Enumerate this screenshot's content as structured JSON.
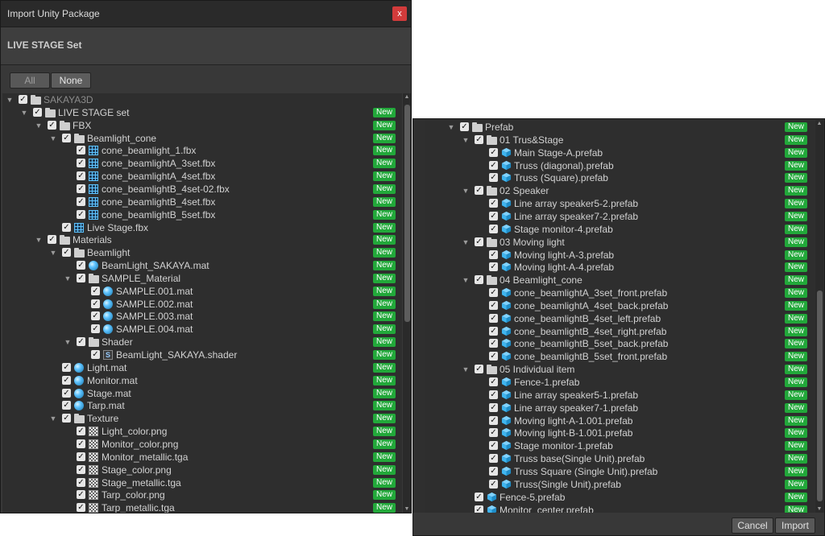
{
  "dialog": {
    "title": "Import Unity Package",
    "close_label": "x",
    "package_name": "LIVE STAGE Set",
    "all_label": "All",
    "none_label": "None",
    "new_label": "New",
    "cancel_label": "Cancel",
    "import_label": "Import"
  },
  "left_tree": [
    {
      "label": "SAKAYA3D",
      "depth": 0,
      "icon": "folder-icon",
      "fold": true,
      "dim": true,
      "badge": false
    },
    {
      "label": "LIVE STAGE set",
      "depth": 1,
      "icon": "folder-icon",
      "fold": true,
      "badge": true
    },
    {
      "label": "FBX",
      "depth": 2,
      "icon": "folder-icon",
      "fold": true,
      "badge": true
    },
    {
      "label": "Beamlight_cone",
      "depth": 3,
      "icon": "folder-icon",
      "fold": true,
      "badge": true
    },
    {
      "label": "cone_beamlight_1.fbx",
      "depth": 4,
      "icon": "fbx-icon",
      "badge": true
    },
    {
      "label": "cone_beamlightA_3set.fbx",
      "depth": 4,
      "icon": "fbx-icon",
      "badge": true
    },
    {
      "label": "cone_beamlightA_4set.fbx",
      "depth": 4,
      "icon": "fbx-icon",
      "badge": true
    },
    {
      "label": "cone_beamlightB_4set-02.fbx",
      "depth": 4,
      "icon": "fbx-icon",
      "badge": true
    },
    {
      "label": "cone_beamlightB_4set.fbx",
      "depth": 4,
      "icon": "fbx-icon",
      "badge": true
    },
    {
      "label": "cone_beamlightB_5set.fbx",
      "depth": 4,
      "icon": "fbx-icon",
      "badge": true
    },
    {
      "label": "Live Stage.fbx",
      "depth": 3,
      "icon": "fbx-icon",
      "badge": true
    },
    {
      "label": "Materials",
      "depth": 2,
      "icon": "folder-icon",
      "fold": true,
      "badge": true
    },
    {
      "label": "Beamlight",
      "depth": 3,
      "icon": "folder-icon",
      "fold": true,
      "badge": true
    },
    {
      "label": "BeamLight_SAKAYA.mat",
      "depth": 4,
      "icon": "material-icon",
      "badge": true
    },
    {
      "label": "SAMPLE_Material",
      "depth": 4,
      "icon": "folder-icon",
      "fold": true,
      "badge": true
    },
    {
      "label": "SAMPLE.001.mat",
      "depth": 5,
      "icon": "material-icon",
      "badge": true
    },
    {
      "label": "SAMPLE.002.mat",
      "depth": 5,
      "icon": "material-icon",
      "badge": true
    },
    {
      "label": "SAMPLE.003.mat",
      "depth": 5,
      "icon": "material-icon",
      "badge": true
    },
    {
      "label": "SAMPLE.004.mat",
      "depth": 5,
      "icon": "material-icon",
      "badge": true
    },
    {
      "label": "Shader",
      "depth": 4,
      "icon": "folder-icon",
      "fold": true,
      "badge": true
    },
    {
      "label": "BeamLight_SAKAYA.shader",
      "depth": 5,
      "icon": "shader-icon",
      "badge": true
    },
    {
      "label": "Light.mat",
      "depth": 3,
      "icon": "material-icon",
      "badge": true
    },
    {
      "label": "Monitor.mat",
      "depth": 3,
      "icon": "material-icon",
      "badge": true
    },
    {
      "label": "Stage.mat",
      "depth": 3,
      "icon": "material-icon",
      "badge": true
    },
    {
      "label": "Tarp.mat",
      "depth": 3,
      "icon": "material-icon",
      "badge": true
    },
    {
      "label": "Texture",
      "depth": 3,
      "icon": "folder-icon",
      "fold": true,
      "badge": true
    },
    {
      "label": "Light_color.png",
      "depth": 4,
      "icon": "texture-icon",
      "badge": true
    },
    {
      "label": "Monitor_color.png",
      "depth": 4,
      "icon": "texture-icon",
      "badge": true
    },
    {
      "label": "Monitor_metallic.tga",
      "depth": 4,
      "icon": "texture-icon",
      "badge": true
    },
    {
      "label": "Stage_color.png",
      "depth": 4,
      "icon": "texture-icon",
      "badge": true
    },
    {
      "label": "Stage_metallic.tga",
      "depth": 4,
      "icon": "texture-icon",
      "badge": true
    },
    {
      "label": "Tarp_color.png",
      "depth": 4,
      "icon": "texture-icon",
      "badge": true
    },
    {
      "label": "Tarp_metallic.tga",
      "depth": 4,
      "icon": "texture-icon",
      "badge": true
    }
  ],
  "right_tree": [
    {
      "label": "Prefab",
      "depth": 2,
      "icon": "folder-icon",
      "fold": true,
      "badge": true
    },
    {
      "label": "01 Trus&Stage",
      "depth": 3,
      "icon": "folder-icon",
      "fold": true,
      "badge": true
    },
    {
      "label": "Main Stage-A.prefab",
      "depth": 4,
      "icon": "prefab-icon",
      "badge": true
    },
    {
      "label": "Truss (diagonal).prefab",
      "depth": 4,
      "icon": "prefab-icon",
      "badge": true
    },
    {
      "label": "Truss (Square).prefab",
      "depth": 4,
      "icon": "prefab-icon",
      "badge": true
    },
    {
      "label": "02 Speaker",
      "depth": 3,
      "icon": "folder-icon",
      "fold": true,
      "badge": true
    },
    {
      "label": "Line array speaker5-2.prefab",
      "depth": 4,
      "icon": "prefab-icon",
      "badge": true
    },
    {
      "label": "Line array speaker7-2.prefab",
      "depth": 4,
      "icon": "prefab-icon",
      "badge": true
    },
    {
      "label": "Stage monitor-4.prefab",
      "depth": 4,
      "icon": "prefab-icon",
      "badge": true
    },
    {
      "label": "03 Moving light",
      "depth": 3,
      "icon": "folder-icon",
      "fold": true,
      "badge": true
    },
    {
      "label": "Moving light-A-3.prefab",
      "depth": 4,
      "icon": "prefab-icon",
      "badge": true
    },
    {
      "label": "Moving light-A-4.prefab",
      "depth": 4,
      "icon": "prefab-icon",
      "badge": true
    },
    {
      "label": "04 Beamlight_cone",
      "depth": 3,
      "icon": "folder-icon",
      "fold": true,
      "badge": true
    },
    {
      "label": "cone_beamlightA_3set_front.prefab",
      "depth": 4,
      "icon": "prefab-icon",
      "badge": true
    },
    {
      "label": "cone_beamlightA_4set_back.prefab",
      "depth": 4,
      "icon": "prefab-icon",
      "badge": true
    },
    {
      "label": "cone_beamlightB_4set_left.prefab",
      "depth": 4,
      "icon": "prefab-icon",
      "badge": true
    },
    {
      "label": "cone_beamlightB_4set_right.prefab",
      "depth": 4,
      "icon": "prefab-icon",
      "badge": true
    },
    {
      "label": "cone_beamlightB_5set_back.prefab",
      "depth": 4,
      "icon": "prefab-icon",
      "badge": true
    },
    {
      "label": "cone_beamlightB_5set_front.prefab",
      "depth": 4,
      "icon": "prefab-icon",
      "badge": true
    },
    {
      "label": "05 Individual item",
      "depth": 3,
      "icon": "folder-icon",
      "fold": true,
      "badge": true
    },
    {
      "label": "Fence-1.prefab",
      "depth": 4,
      "icon": "prefab-icon",
      "badge": true
    },
    {
      "label": "Line array speaker5-1.prefab",
      "depth": 4,
      "icon": "prefab-icon",
      "badge": true
    },
    {
      "label": "Line array speaker7-1.prefab",
      "depth": 4,
      "icon": "prefab-icon",
      "badge": true
    },
    {
      "label": "Moving light-A-1.001.prefab",
      "depth": 4,
      "icon": "prefab-icon",
      "badge": true
    },
    {
      "label": "Moving light-B-1.001.prefab",
      "depth": 4,
      "icon": "prefab-icon",
      "badge": true
    },
    {
      "label": "Stage monitor-1.prefab",
      "depth": 4,
      "icon": "prefab-icon",
      "badge": true
    },
    {
      "label": "Truss base(Single Unit).prefab",
      "depth": 4,
      "icon": "prefab-icon",
      "badge": true
    },
    {
      "label": "Truss Square (Single Unit).prefab",
      "depth": 4,
      "icon": "prefab-icon",
      "badge": true
    },
    {
      "label": "Truss(Single Unit).prefab",
      "depth": 4,
      "icon": "prefab-icon",
      "badge": true
    },
    {
      "label": "Fence-5.prefab",
      "depth": 3,
      "icon": "prefab-icon",
      "badge": true
    },
    {
      "label": "Monitor_center.prefab",
      "depth": 3,
      "icon": "prefab-icon",
      "badge": true
    }
  ],
  "colors": {
    "new_badge": "#22a83a",
    "prefab_blue": "#3fb5f0",
    "close_red": "#d23b3b"
  }
}
